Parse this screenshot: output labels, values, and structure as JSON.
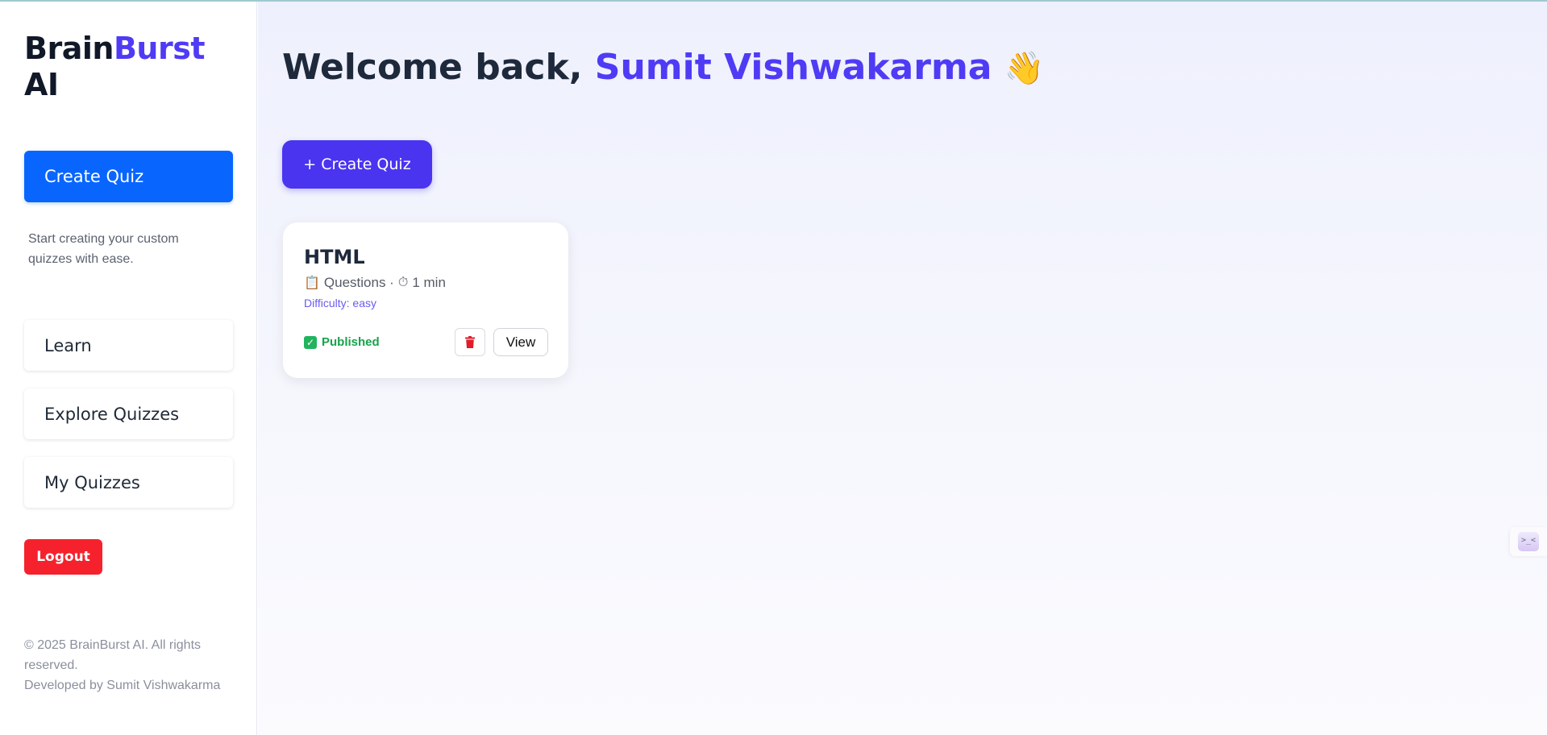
{
  "sidebar": {
    "brand": {
      "part1": "Brain",
      "part2": "Burst",
      "part3": "AI"
    },
    "create_quiz_label": "Create Quiz",
    "description": "Start creating your custom quizzes with ease.",
    "nav": [
      {
        "label": "Learn"
      },
      {
        "label": "Explore Quizzes"
      },
      {
        "label": "My Quizzes"
      }
    ],
    "logout_label": "Logout",
    "footer": {
      "copyright": "© 2025 BrainBurst AI. All rights reserved.",
      "developer": "Developed by Sumit Vishwakarma"
    }
  },
  "main": {
    "welcome_prefix": "Welcome back, ",
    "user_name": "Sumit Vishwakarma",
    "wave_emoji": "👋",
    "create_quiz_label": "+ Create Quiz",
    "quizzes": [
      {
        "title": "HTML",
        "questions_emoji": "📋",
        "questions_label": "Questions ·",
        "timer_emoji": "⏱",
        "duration": "1 min",
        "difficulty": "Difficulty: easy",
        "status_check": "✓",
        "status": "Published",
        "view_label": "View"
      }
    ]
  },
  "widget": {
    "face": ">_<"
  },
  "colors": {
    "accent": "#4f3bf5",
    "primary_blue": "#0866ff",
    "danger": "#f5222d",
    "success": "#16a34a"
  },
  "icons": {
    "delete": "trash-icon",
    "questions": "clipboard-icon",
    "timer": "stopwatch-icon",
    "status": "check-icon"
  }
}
